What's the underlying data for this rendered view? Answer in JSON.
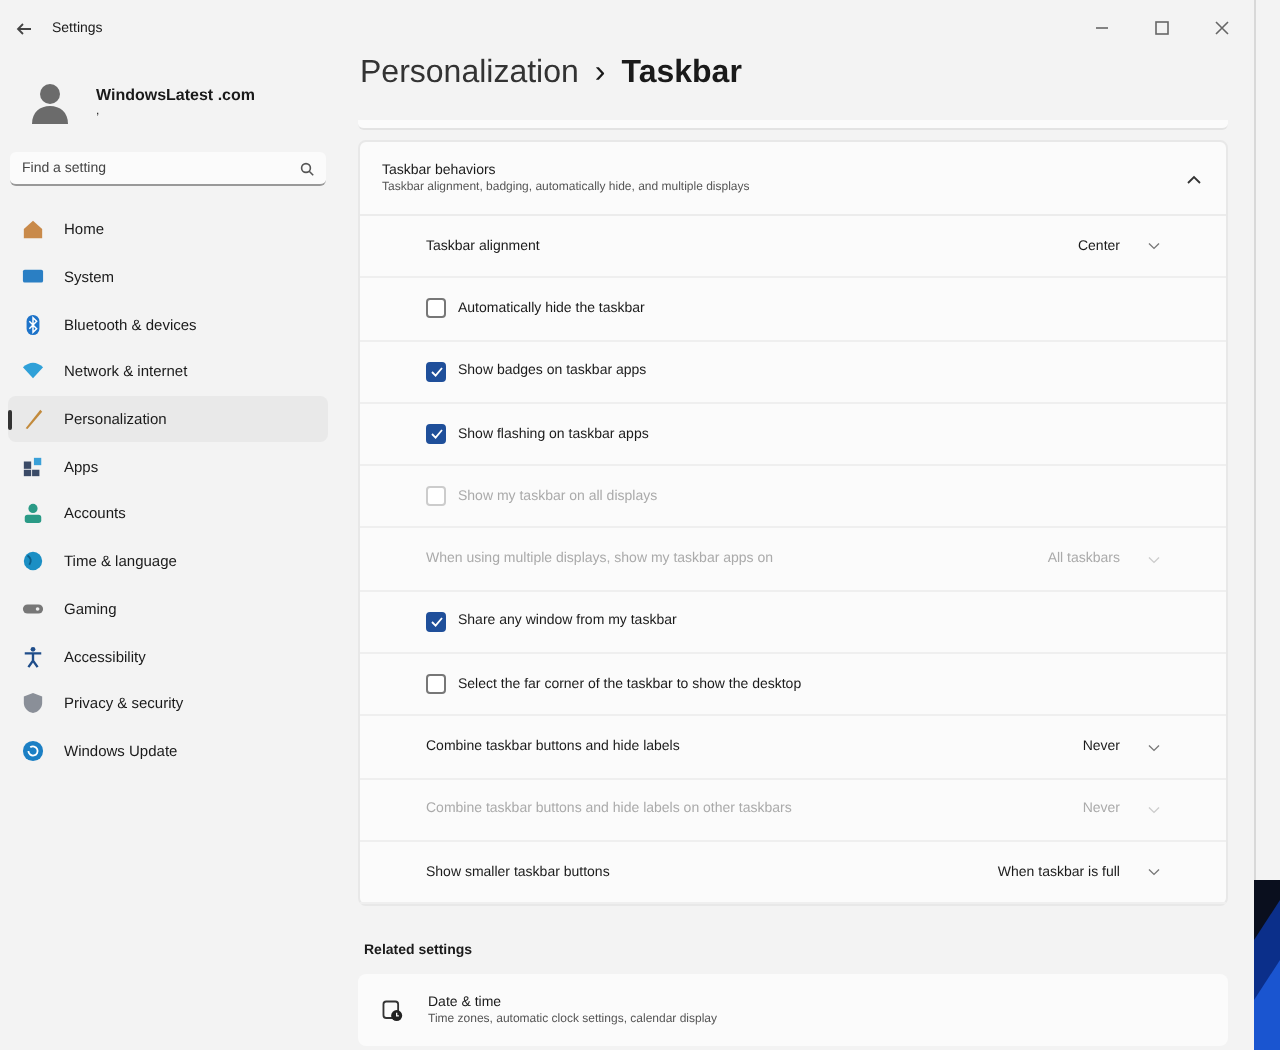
{
  "window": {
    "title": "Settings"
  },
  "account": {
    "name": "WindowsLatest .com",
    "detail": ","
  },
  "search": {
    "placeholder": "Find a setting"
  },
  "sidebar": {
    "items": [
      {
        "label": "Home",
        "selected": false
      },
      {
        "label": "System",
        "selected": false
      },
      {
        "label": "Bluetooth & devices",
        "selected": false
      },
      {
        "label": "Network & internet",
        "selected": false
      },
      {
        "label": "Personalization",
        "selected": true
      },
      {
        "label": "Apps",
        "selected": false
      },
      {
        "label": "Accounts",
        "selected": false
      },
      {
        "label": "Time & language",
        "selected": false
      },
      {
        "label": "Gaming",
        "selected": false
      },
      {
        "label": "Accessibility",
        "selected": false
      },
      {
        "label": "Privacy & security",
        "selected": false
      },
      {
        "label": "Windows Update",
        "selected": false
      }
    ]
  },
  "breadcrumb": {
    "parent": "Personalization",
    "separator": "›",
    "current": "Taskbar"
  },
  "section": {
    "title": "Taskbar behaviors",
    "description": "Taskbar alignment, badging, automatically hide, and multiple displays",
    "expanded": true,
    "rows": [
      {
        "kind": "dropdown",
        "label": "Taskbar alignment",
        "value": "Center",
        "disabled": false
      },
      {
        "kind": "checkbox",
        "label": "Automatically hide the taskbar",
        "checked": false,
        "disabled": false
      },
      {
        "kind": "checkbox",
        "label": "Show badges on taskbar apps",
        "checked": true,
        "disabled": false
      },
      {
        "kind": "checkbox",
        "label": "Show flashing on taskbar apps",
        "checked": true,
        "disabled": false
      },
      {
        "kind": "checkbox",
        "label": "Show my taskbar on all displays",
        "checked": false,
        "disabled": true
      },
      {
        "kind": "dropdown",
        "label": "When using multiple displays, show my taskbar apps on",
        "value": "All taskbars",
        "disabled": true
      },
      {
        "kind": "checkbox",
        "label": "Share any window from my taskbar",
        "checked": true,
        "disabled": false
      },
      {
        "kind": "checkbox",
        "label": "Select the far corner of the taskbar to show the desktop",
        "checked": false,
        "disabled": false
      },
      {
        "kind": "dropdown",
        "label": "Combine taskbar buttons and hide labels",
        "value": "Never",
        "disabled": false
      },
      {
        "kind": "dropdown",
        "label": "Combine taskbar buttons and hide labels on other taskbars",
        "value": "Never",
        "disabled": true
      },
      {
        "kind": "dropdown",
        "label": "Show smaller taskbar buttons",
        "value": "When taskbar is full",
        "disabled": false
      }
    ]
  },
  "related": {
    "title": "Related settings",
    "items": [
      {
        "title": "Date & time",
        "description": "Time zones, automatic clock settings, calendar display"
      }
    ]
  }
}
